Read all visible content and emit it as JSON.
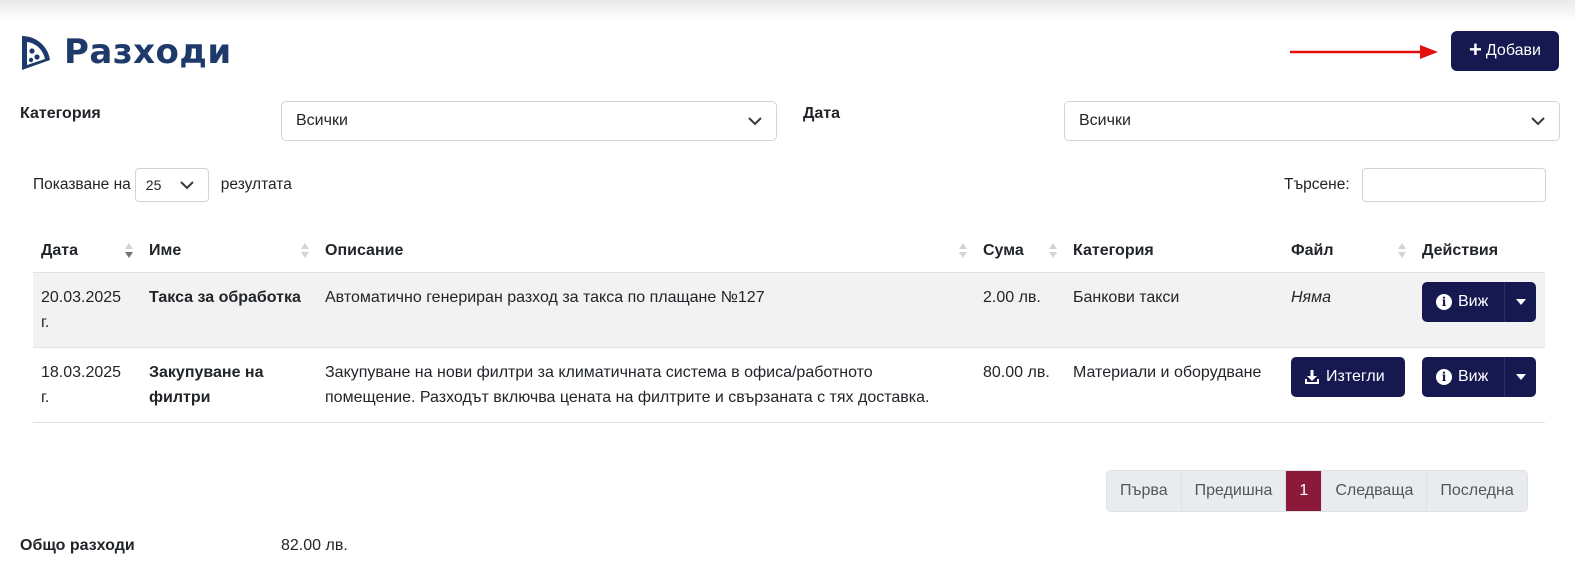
{
  "header": {
    "title": "Разходи",
    "logo_icon": "pizza-slice-icon",
    "add_label": "Добави",
    "brand_color": "#161850",
    "title_color": "#1e3a6b"
  },
  "filters": {
    "category_label": "Категория",
    "category_value": "Всички",
    "date_label": "Дата",
    "date_value": "Всички"
  },
  "table_controls": {
    "show_prefix": "Показване на",
    "page_length": "25",
    "show_suffix": "резултата",
    "search_label": "Търсене:",
    "search_value": ""
  },
  "table": {
    "columns": [
      "Дата",
      "Име",
      "Описание",
      "Сума",
      "Категория",
      "Файл",
      "Действия"
    ],
    "rows": [
      {
        "date": "20.03.2025 г.",
        "name": "Такса за обработка",
        "description": "Автоматично генериран разход за такса по плащане №127",
        "amount": "2.00 лв.",
        "category": "Банкови такси",
        "file": "Няма",
        "action": "Виж"
      },
      {
        "date": "18.03.2025 г.",
        "name": "Закупуване на филтри",
        "description": "Закупуване на нови филтри за климатичната система в офиса/работното помещение. Разходът включва цената на филтрите и свързаната с тях доставка.",
        "amount": "80.00 лв.",
        "category": "Материали и оборудване",
        "file": "Изтегли",
        "action": "Виж"
      }
    ]
  },
  "pagination": {
    "first": "Първа",
    "previous": "Предишна",
    "current": "1",
    "next": "Следваща",
    "last": "Последна",
    "active_color": "#8b1a3a"
  },
  "summary": {
    "total_label": "Общо разходи",
    "total_value": "82.00 лв."
  }
}
